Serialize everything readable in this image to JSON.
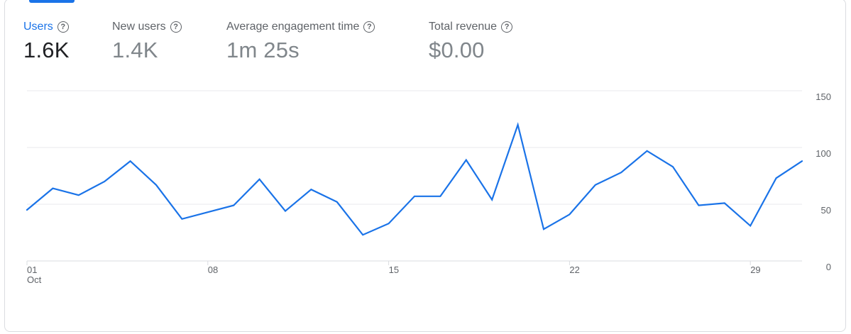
{
  "metrics": [
    {
      "label": "Users",
      "value": "1.6K",
      "active": true,
      "help_icon": "help-circle-icon"
    },
    {
      "label": "New users",
      "value": "1.4K",
      "active": false,
      "help_icon": "help-circle-icon"
    },
    {
      "label": "Average engagement time",
      "value": "1m 25s",
      "active": false,
      "help_icon": "help-circle-icon"
    },
    {
      "label": "Total revenue",
      "value": "$0.00",
      "active": false,
      "help_icon": "help-circle-icon"
    }
  ],
  "colors": {
    "accent": "#1a73e8",
    "line": "#1a73e8",
    "grid": "#e8eaed",
    "text_secondary": "#5f6368"
  },
  "chart_data": {
    "type": "line",
    "series": [
      {
        "x": [
          1,
          2,
          3,
          4,
          5,
          6,
          7,
          8,
          9,
          10,
          11,
          12,
          13,
          14,
          15,
          16,
          17,
          18,
          19,
          20,
          21,
          22,
          23,
          24,
          25,
          26,
          27,
          28,
          29,
          30,
          31
        ],
        "values": [
          45,
          64,
          58,
          70,
          88,
          67,
          37,
          43,
          49,
          72,
          44,
          63,
          52,
          23,
          33,
          57,
          57,
          89,
          54,
          120,
          28,
          41,
          67,
          78,
          97,
          83,
          49,
          51,
          31,
          73,
          88
        ]
      }
    ],
    "ylim": [
      0,
      150
    ],
    "yticks": [
      150,
      100,
      50,
      0
    ],
    "xtick_labels": [
      {
        "day": 1,
        "label": "01",
        "sub": "Oct"
      },
      {
        "day": 8,
        "label": "08",
        "sub": ""
      },
      {
        "day": 15,
        "label": "15",
        "sub": ""
      },
      {
        "day": 22,
        "label": "22",
        "sub": ""
      },
      {
        "day": 29,
        "label": "29",
        "sub": ""
      }
    ],
    "grid": true
  }
}
